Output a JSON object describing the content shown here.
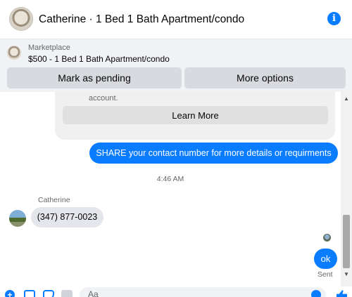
{
  "header": {
    "title": "Catherine · 1 Bed 1 Bath Apartment/condo",
    "info_icon": "info-icon",
    "info_glyph": "i"
  },
  "marketplace": {
    "label": "Marketplace",
    "listing": "$500 - 1 Bed 1 Bath Apartment/condo",
    "buttons": {
      "pending": "Mark as pending",
      "more": "More options"
    }
  },
  "messages": {
    "card_text": "account.",
    "learn_more": "Learn More",
    "outgoing_share": "SHARE your contact number for more details or requirments",
    "timestamp": "4:46 AM",
    "sender_name": "Catherine",
    "incoming_phone": "(347) 877-0023",
    "outgoing_ok": "ok",
    "status": "Sent"
  },
  "composer": {
    "input_value": "",
    "placeholder": "Aa",
    "icons": [
      "plus-icon",
      "photo-icon",
      "sticker-icon",
      "gif-icon",
      "emoji-icon",
      "like-icon"
    ]
  },
  "colors": {
    "accent": "#0a7cff",
    "incoming_bubble": "#e4e6eb",
    "panel_bg": "#f0f2f5",
    "button_bg": "#d8dadf",
    "secondary_text": "#65676b"
  }
}
